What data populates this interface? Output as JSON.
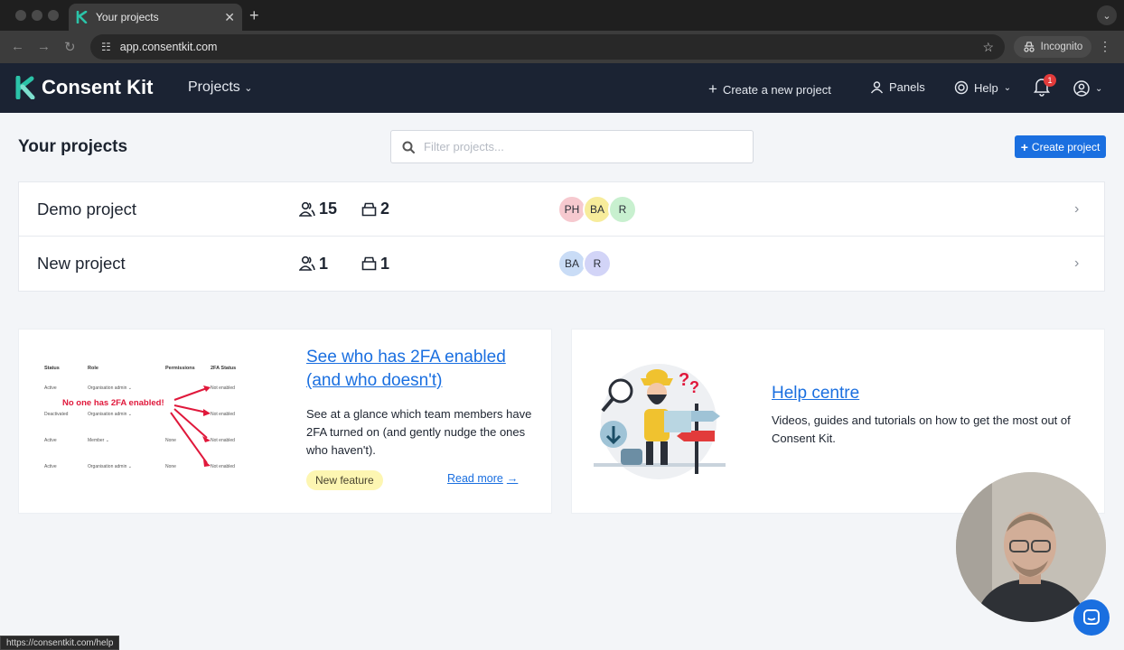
{
  "browser": {
    "tab_title": "Your projects",
    "tab_close": "✕",
    "new_tab": "+",
    "url": "app.consentkit.com",
    "incognito_label": "Incognito",
    "status_url": "https://consentkit.com/help"
  },
  "header": {
    "brand": "Consent Kit",
    "projects_menu": "Projects",
    "create_new_project": "Create a new project",
    "panels": "Panels",
    "help": "Help",
    "notifications_count": "1"
  },
  "page": {
    "title": "Your projects",
    "filter_placeholder": "Filter projects...",
    "create_button": "Create project"
  },
  "projects": [
    {
      "name": "Demo project",
      "members": "15",
      "panels": "2",
      "avatars": [
        {
          "initials": "PH",
          "color": "#f6c9cf"
        },
        {
          "initials": "BA",
          "color": "#f7ec9b"
        },
        {
          "initials": "R",
          "color": "#c8f0cf"
        }
      ]
    },
    {
      "name": "New project",
      "members": "1",
      "panels": "1",
      "avatars": [
        {
          "initials": "BA",
          "color": "#c9dcf6"
        },
        {
          "initials": "R",
          "color": "#d2d4f7"
        }
      ]
    }
  ],
  "feature_card": {
    "title": "See who has 2FA enabled (and who doesn't)",
    "body": "See at a glance which team members have 2FA turned on (and gently nudge the ones who haven't).",
    "badge": "New feature",
    "read_more": "Read more",
    "mini": {
      "headers": [
        "Status",
        "Role",
        "Permissions",
        "2FA Status"
      ],
      "rows": [
        [
          "Active",
          "Organisation admin ⌄",
          "None",
          "Not enabled"
        ],
        [
          "Deactivated",
          "Organisation admin ⌄",
          "None",
          "Not enabled"
        ],
        [
          "Active",
          "Member ⌄",
          "None",
          "Not enabled"
        ],
        [
          "Active",
          "Organisation admin ⌄",
          "None",
          "Not enabled"
        ]
      ],
      "callout": "No one has 2FA enabled!"
    }
  },
  "help_card": {
    "title": "Help centre",
    "body": "Videos, guides and tutorials on how to get the most out of Consent Kit."
  },
  "colors": {
    "brand_blue": "#1a6fe0",
    "header_bg": "#1b2333",
    "logo_teal": "#2bc3a8",
    "accent_red": "#e0183b"
  }
}
